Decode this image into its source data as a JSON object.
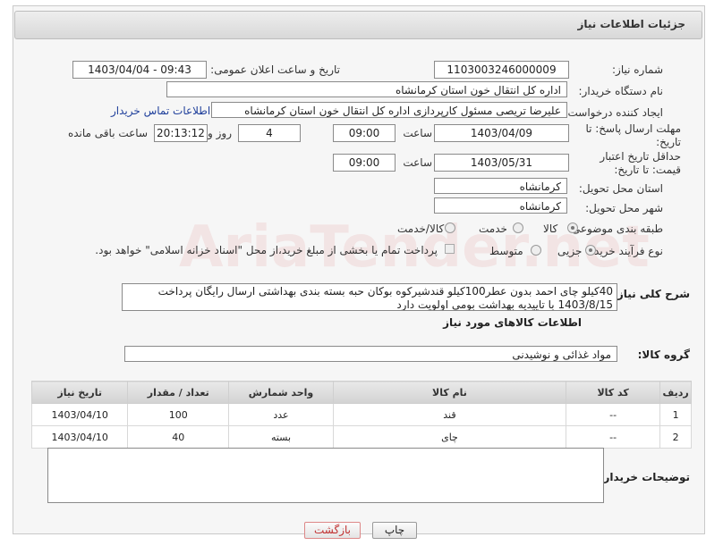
{
  "header": {
    "title": "جزئیات اطلاعات نیاز"
  },
  "watermark": "AriaTender.net",
  "fields": {
    "need_number_label": "شماره نیاز:",
    "need_number": "1103003246000009",
    "announce_label": "تاریخ و ساعت اعلان عمومی:",
    "announce_value": "1403/04/04 - 09:43",
    "buyer_org_label": "نام دستگاه خریدار:",
    "buyer_org": "اداره کل انتقال خون استان کرمانشاه",
    "creator_label": "ایجاد کننده درخواست:",
    "creator": "علیرضا تریصی مسئول کارپردازی اداره کل انتقال خون استان کرمانشاه",
    "contact_link": "اطلاعات تماس خریدار",
    "reply_deadline_label": "مهلت ارسال پاسخ: تا تاریخ:",
    "reply_date": "1403/04/09",
    "time_label": "ساعت",
    "reply_time": "09:00",
    "days_value": "4",
    "days_label": "روز و",
    "remaining_time": "20:13:12",
    "remaining_label": "ساعت باقی مانده",
    "price_validity_label": "حداقل تاریخ اعتبار قیمت: تا تاریخ:",
    "price_validity_date": "1403/05/31",
    "price_validity_time": "09:00",
    "delivery_province_label": "استان محل تحویل:",
    "delivery_province": "کرمانشاه",
    "delivery_city_label": "شهر محل تحویل:",
    "delivery_city": "کرمانشاه",
    "subject_label": "طبقه بندی موضوعی:",
    "subject_options": [
      "کالا",
      "خدمت",
      "کالا/خدمت"
    ],
    "process_label": "نوع فرآیند خرید :",
    "process_options": [
      "جزیی",
      "متوسط"
    ],
    "payment_note": "پرداخت تمام یا بخشی از مبلغ خرید،از محل \"اسناد خزانه اسلامی\" خواهد بود.",
    "description_label": "شرح کلی نیاز:",
    "description_line1": "40کیلو چای احمد بدون عطر100کیلو قندشیرکوه بوکان حبه بسته بندی بهداشتی ارسال رایگان پرداخت",
    "description_line2": "1403/8/15 با تاییدیه بهداشت  بومی اولویت دارد"
  },
  "goods": {
    "section_title": "اطلاعات کالاهای مورد نیاز",
    "group_label": "گروه کالا:",
    "group_value": "مواد غذائی و نوشیدنی",
    "columns": [
      "ردیف",
      "کد کالا",
      "نام کالا",
      "واحد شمارش",
      "تعداد / مقدار",
      "تاریخ نیاز"
    ],
    "rows": [
      {
        "row": "1",
        "code": "--",
        "name": "قند",
        "unit": "عدد",
        "qty": "100",
        "date": "1403/04/10"
      },
      {
        "row": "2",
        "code": "--",
        "name": "چای",
        "unit": "بسته",
        "qty": "40",
        "date": "1403/04/10"
      }
    ]
  },
  "buyer_notes_label": "توضیحات خریدار:",
  "buttons": {
    "print": "چاپ",
    "back": "بازگشت"
  }
}
